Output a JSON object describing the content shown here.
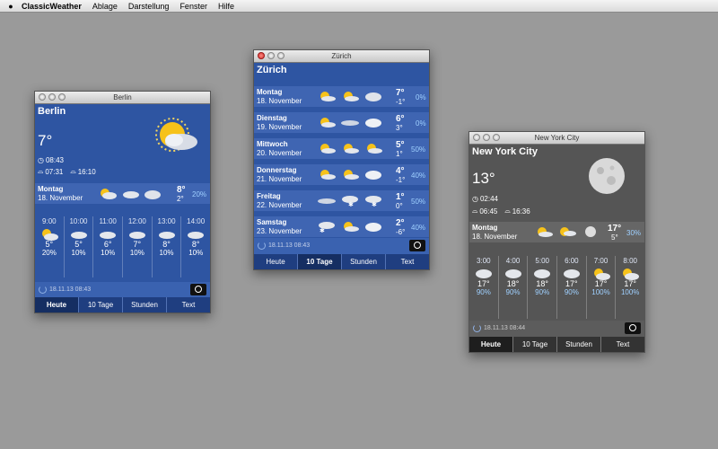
{
  "menubar": {
    "app": "ClassicWeather",
    "items": [
      "Ablage",
      "Darstellung",
      "Fenster",
      "Hilfe"
    ]
  },
  "berlin": {
    "title": "Berlin",
    "city": "Berlin",
    "temp": "7°",
    "time": "08:43",
    "sunrise": "07:31",
    "sunset": "16:10",
    "day": {
      "name": "Montag",
      "date": "18. November",
      "hi": "8°",
      "lo": "2°",
      "pct": "20%"
    },
    "hours": [
      {
        "t": "9:00",
        "temp": "5°",
        "pct": "20%"
      },
      {
        "t": "10:00",
        "temp": "5°",
        "pct": "10%"
      },
      {
        "t": "11:00",
        "temp": "6°",
        "pct": "10%"
      },
      {
        "t": "12:00",
        "temp": "7°",
        "pct": "10%"
      },
      {
        "t": "13:00",
        "temp": "8°",
        "pct": "10%"
      },
      {
        "t": "14:00",
        "temp": "8°",
        "pct": "10%"
      }
    ],
    "updated": "18.11.13 08:43"
  },
  "zurich": {
    "title": "Zürich",
    "city": "Zürich",
    "days": [
      {
        "name": "Montag",
        "date": "18. November",
        "hi": "7°",
        "lo": "-1°",
        "pct": "0%"
      },
      {
        "name": "Dienstag",
        "date": "19. November",
        "hi": "6°",
        "lo": "3°",
        "pct": "0%"
      },
      {
        "name": "Mittwoch",
        "date": "20. November",
        "hi": "5°",
        "lo": "1°",
        "pct": "50%"
      },
      {
        "name": "Donnerstag",
        "date": "21. November",
        "hi": "4°",
        "lo": "-1°",
        "pct": "40%"
      },
      {
        "name": "Freitag",
        "date": "22. November",
        "hi": "1°",
        "lo": "0°",
        "pct": "50%"
      },
      {
        "name": "Samstag",
        "date": "23. November",
        "hi": "2°",
        "lo": "-6°",
        "pct": "40%"
      }
    ],
    "updated": "18.11.13 08:43"
  },
  "newyork": {
    "title": "New York City",
    "city": "New York City",
    "temp": "13°",
    "time": "02:44",
    "sunrise": "06:45",
    "sunset": "16:36",
    "day": {
      "name": "Montag",
      "date": "18. November",
      "hi": "17°",
      "lo": "5°",
      "pct": "30%"
    },
    "hours": [
      {
        "t": "3:00",
        "temp": "17°",
        "pct": "90%"
      },
      {
        "t": "4:00",
        "temp": "18°",
        "pct": "90%"
      },
      {
        "t": "5:00",
        "temp": "18°",
        "pct": "90%"
      },
      {
        "t": "6:00",
        "temp": "17°",
        "pct": "90%"
      },
      {
        "t": "7:00",
        "temp": "17°",
        "pct": "100%"
      },
      {
        "t": "8:00",
        "temp": "17°",
        "pct": "100%"
      }
    ],
    "updated": "18.11.13 08:44"
  },
  "tabs": [
    "Heute",
    "10 Tage",
    "Stunden",
    "Text"
  ],
  "colors": {
    "blue": "#2e55a2",
    "gray": "#555555"
  }
}
